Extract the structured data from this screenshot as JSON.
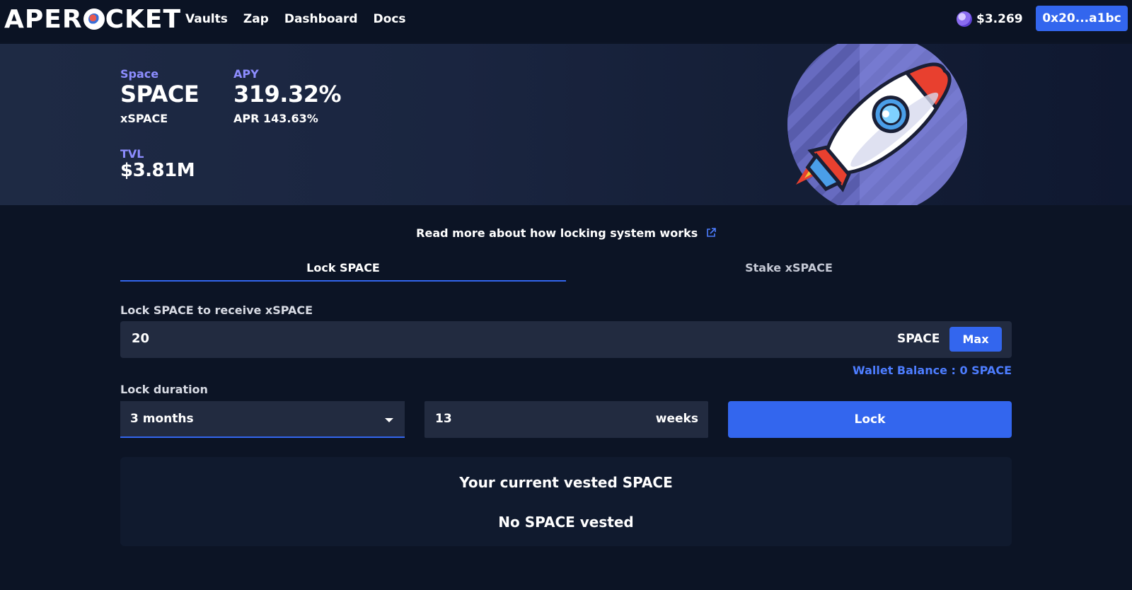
{
  "header": {
    "logo_left": "APER",
    "logo_right": "CKET",
    "nav": [
      "Vaults",
      "Zap",
      "Dashboard",
      "Docs"
    ],
    "token_price": "$3.269",
    "wallet_address": "0x20...a1bc",
    "accent_color": "#3366ee"
  },
  "hero": {
    "name_label": "Space",
    "token": "SPACE",
    "receipt_token": "xSPACE",
    "apy_label": "APY",
    "apy_value": "319.32%",
    "apr_text": "APR 143.63%",
    "tvl_label": "TVL",
    "tvl_value": "$3.81M",
    "illustration": "rocket"
  },
  "main": {
    "readmore_text": "Read more about how locking system works",
    "readmore_icon": "external-link-icon",
    "tabs": [
      {
        "label": "Lock SPACE",
        "active": true
      },
      {
        "label": "Stake xSPACE",
        "active": false
      }
    ],
    "lock_label": "Lock SPACE to receive xSPACE",
    "amount_value": "20",
    "amount_unit": "SPACE",
    "max_label": "Max",
    "wallet_balance": "Wallet Balance : 0 SPACE",
    "duration_label": "Lock duration",
    "duration_selected": "3 months",
    "weeks_value": "13",
    "weeks_unit": "weeks",
    "lock_button": "Lock",
    "vested_title": "Your current vested SPACE",
    "vested_empty": "No SPACE vested"
  }
}
